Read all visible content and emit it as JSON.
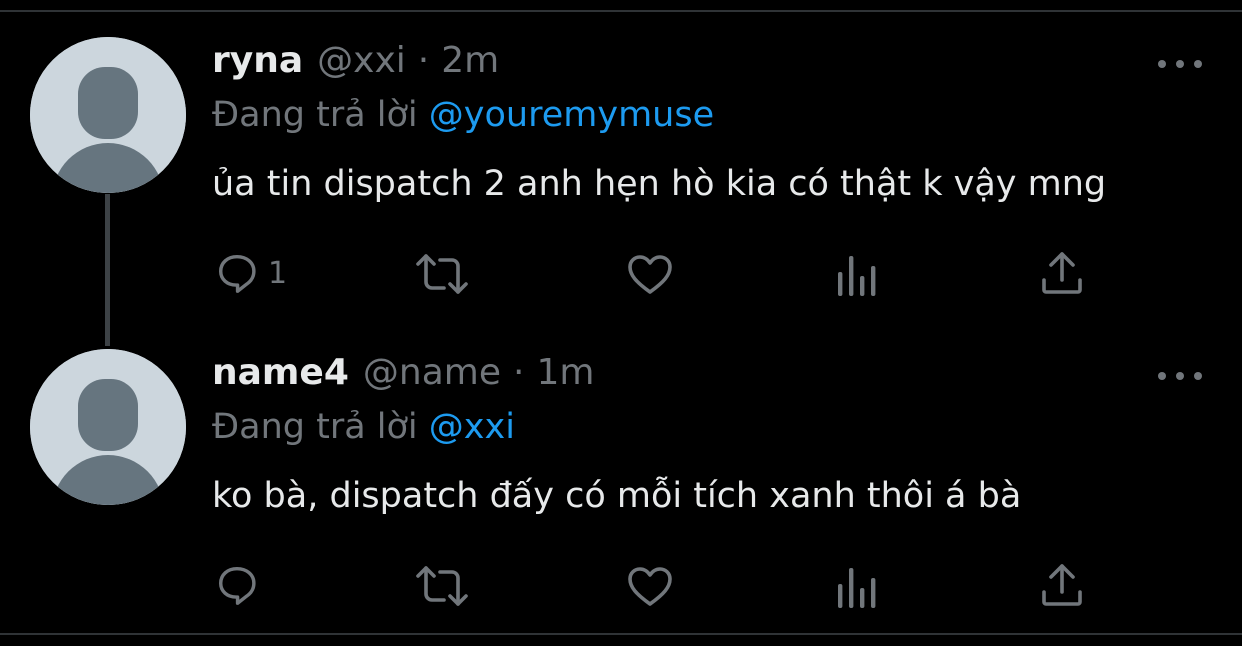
{
  "tweets": [
    {
      "display_name": "ryna",
      "handle": "@xxi",
      "separator": "·",
      "time": "2m",
      "reply_prefix": "Đang trả lời",
      "reply_to": "@youremymuse",
      "text": "ủa tin dispatch 2 anh hẹn hò kia có thật k vậy mng",
      "reply_count": "1",
      "icons": {
        "more": "more-dots-icon",
        "reply": "reply-icon",
        "retweet": "retweet-icon",
        "like": "heart-icon",
        "views": "analytics-icon",
        "share": "share-icon"
      }
    },
    {
      "display_name": "name4",
      "handle": "@name",
      "separator": "·",
      "time": "1m",
      "reply_prefix": "Đang trả lời",
      "reply_to": "@xxi",
      "text": "ko bà, dispatch đấy có mỗi tích xanh thôi á bà",
      "reply_count": "",
      "icons": {
        "more": "more-dots-icon",
        "reply": "reply-icon",
        "retweet": "retweet-icon",
        "like": "heart-icon",
        "views": "analytics-icon",
        "share": "share-icon"
      }
    }
  ],
  "colors": {
    "background": "#000000",
    "text_primary": "#e7e9ea",
    "text_secondary": "#71767b",
    "mention": "#1d9bf0",
    "avatar_bg": "#ccd6dd",
    "avatar_fg": "#66757f",
    "thread_line": "#3d4246"
  }
}
